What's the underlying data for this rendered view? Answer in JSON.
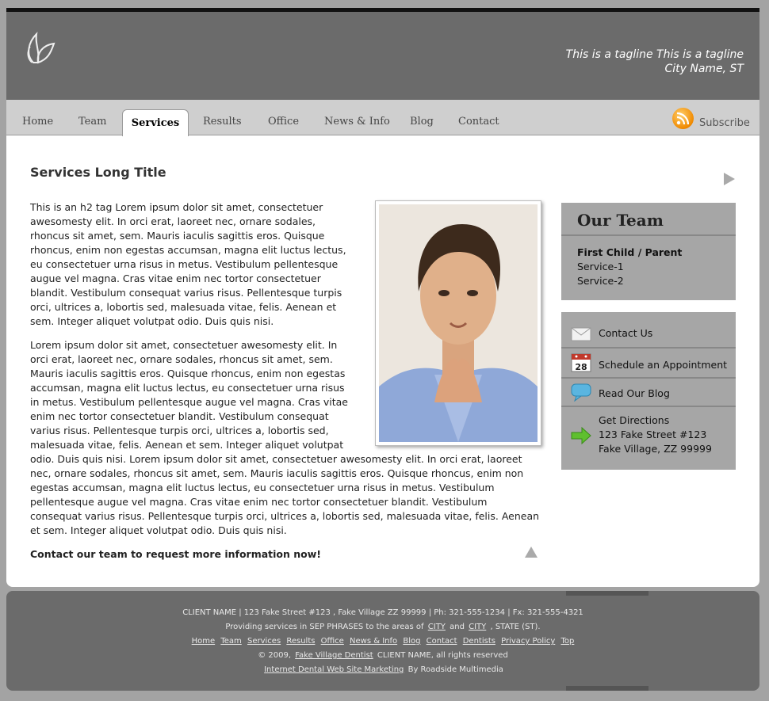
{
  "header": {
    "tagline_line1": "This is a tagline This is a tagline",
    "tagline_line2": "City Name, ST"
  },
  "nav": {
    "tabs": [
      "Home",
      "Team",
      "Services",
      "Results",
      "Office",
      "News & Info",
      "Blog",
      "Contact"
    ],
    "active": "Services",
    "subscribe": "Subscribe"
  },
  "main": {
    "title": "Services Long Title",
    "p1": "This is an h2 tag Lorem ipsum dolor sit amet, consectetuer awesomesty elit. In orci erat, laoreet nec, ornare sodales, rhoncus sit amet, sem. Mauris iaculis sagittis eros. Quisque rhoncus, enim non egestas accumsan, magna elit luctus lectus, eu consectetuer urna risus in metus. Vestibulum pellentesque augue vel magna. Cras vitae enim nec tortor consectetuer blandit. Vestibulum consequat varius risus. Pellentesque turpis orci, ultrices a, lobortis sed, malesuada vitae, felis. Aenean et sem. Integer aliquet volutpat odio. Duis quis nisi.",
    "p2": "Lorem ipsum dolor sit amet, consectetuer awesomesty elit. In orci erat, laoreet nec, ornare sodales, rhoncus sit amet, sem. Mauris iaculis sagittis eros. Quisque rhoncus, enim non egestas accumsan, magna elit luctus lectus, eu consectetuer urna risus in metus. Vestibulum pellentesque augue vel magna. Cras vitae enim nec tortor consectetuer blandit. Vestibulum consequat varius risus. Pellentesque turpis orci, ultrices a, lobortis sed, malesuada vitae, felis. Aenean et sem. Integer aliquet volutpat odio. Duis quis nisi. Lorem ipsum dolor sit amet, consectetuer awesomesty elit. In orci erat, laoreet nec, ornare sodales, rhoncus sit amet, sem. Mauris iaculis sagittis eros. Quisque rhoncus, enim non egestas accumsan, magna elit luctus lectus, eu consectetuer urna risus in metus. Vestibulum pellentesque augue vel magna. Cras vitae enim nec tortor consectetuer blandit. Vestibulum consequat varius risus. Pellentesque turpis orci, ultrices a, lobortis sed, malesuada vitae, felis. Aenean et sem. Integer aliquet volutpat odio. Duis quis nisi.",
    "cta": "Contact our team to request more information now!"
  },
  "sidebar": {
    "team_title": "Our Team",
    "team_items": [
      "First Child / Parent",
      "Service-1",
      "Service-2"
    ],
    "contact_us": "Contact Us",
    "schedule": "Schedule an Appointment",
    "calendar_day": "28",
    "blog": "Read Our Blog",
    "directions_title": "Get Directions",
    "directions_line1": "123 Fake Street #123",
    "directions_line2": "Fake Village, ZZ 99999"
  },
  "footer": {
    "line1": "CLIENT NAME | 123 Fake Street #123 , Fake Village ZZ 99999 | Ph: 321-555-1234 | Fx: 321-555-4321",
    "line2_a": "Providing services in SEP PHRASES to the areas of",
    "city1": "CITY",
    "line2_and": "and",
    "city2": "CITY",
    "line2_b": ", STATE (ST).",
    "links": [
      "Home",
      "Team",
      "Services",
      "Results",
      "Office",
      "News & Info",
      "Blog",
      "Contact",
      "Dentists",
      "Privacy Policy",
      "Top"
    ],
    "copyright_a": "© 2009,",
    "copyright_link": "Fake Village Dentist",
    "copyright_b": "CLIENT NAME, all rights reserved",
    "marketing_link": "Internet Dental Web Site Marketing",
    "marketing_b": "By Roadside Multimedia"
  }
}
